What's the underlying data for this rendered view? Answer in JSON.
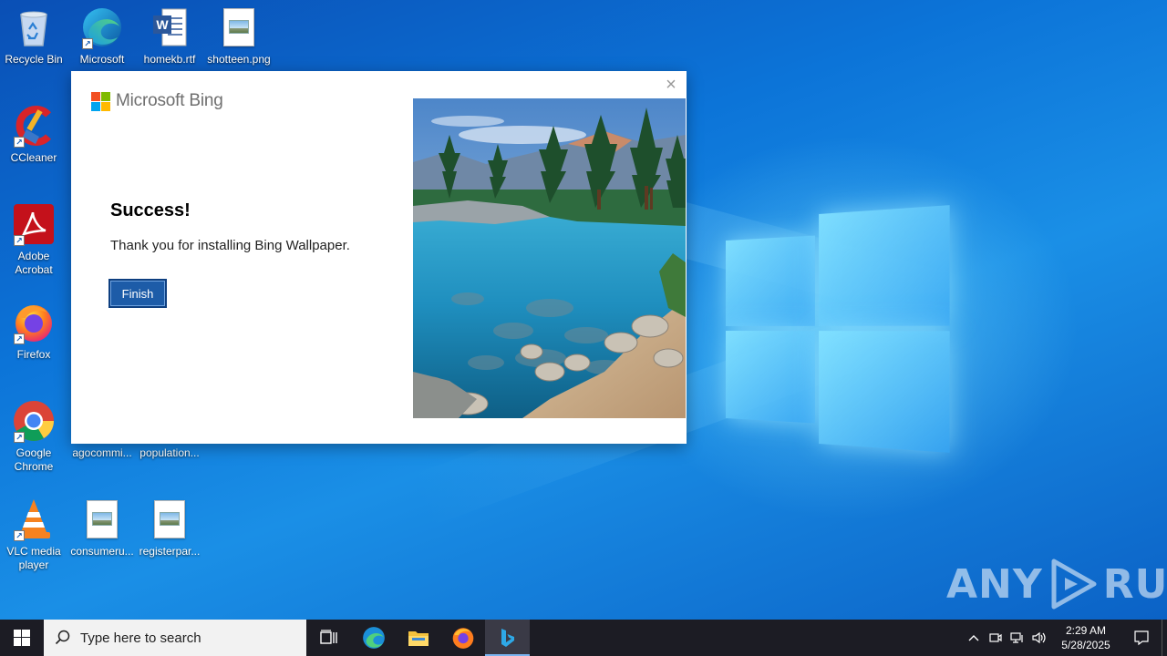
{
  "desktop": {
    "icons": [
      {
        "label": "Recycle Bin",
        "icon": "recycle-bin-icon"
      },
      {
        "label": "Microsoft Edge",
        "icon": "edge-icon"
      },
      {
        "label": "homekb.rtf",
        "icon": "word-document-icon"
      },
      {
        "label": "shotteen.png",
        "icon": "image-file-icon"
      },
      {
        "label": "CCleaner",
        "icon": "ccleaner-icon"
      },
      {
        "label": "Adobe Acrobat",
        "icon": "acrobat-icon"
      },
      {
        "label": "Firefox",
        "icon": "firefox-icon"
      },
      {
        "label": "Google Chrome",
        "icon": "chrome-icon"
      },
      {
        "label": "agocommi...",
        "icon": "file-icon"
      },
      {
        "label": "population...",
        "icon": "file-icon"
      },
      {
        "label": "VLC media player",
        "icon": "vlc-icon"
      },
      {
        "label": "consumeru...",
        "icon": "image-file-icon"
      },
      {
        "label": "registerpar...",
        "icon": "image-file-icon"
      }
    ]
  },
  "dialog": {
    "brand": "Microsoft Bing",
    "close_symbol": "×",
    "title": "Success!",
    "message": "Thank you for installing Bing Wallpaper.",
    "finish_label": "Finish",
    "colors": {
      "ms_red": "#f25022",
      "ms_green": "#7fba00",
      "ms_blue": "#00a4ef",
      "ms_yellow": "#ffb900",
      "button": "#1d5ca8"
    }
  },
  "watermark": {
    "text_left": "ANY",
    "text_right": "RUN"
  },
  "taskbar": {
    "search_placeholder": "Type here to search",
    "pinned": [
      "task-view-icon",
      "edge-icon",
      "file-explorer-icon",
      "firefox-icon",
      "bing-icon"
    ],
    "active_app": "bing-icon",
    "clock_time": "2:29 AM",
    "clock_date": "5/28/2025"
  }
}
